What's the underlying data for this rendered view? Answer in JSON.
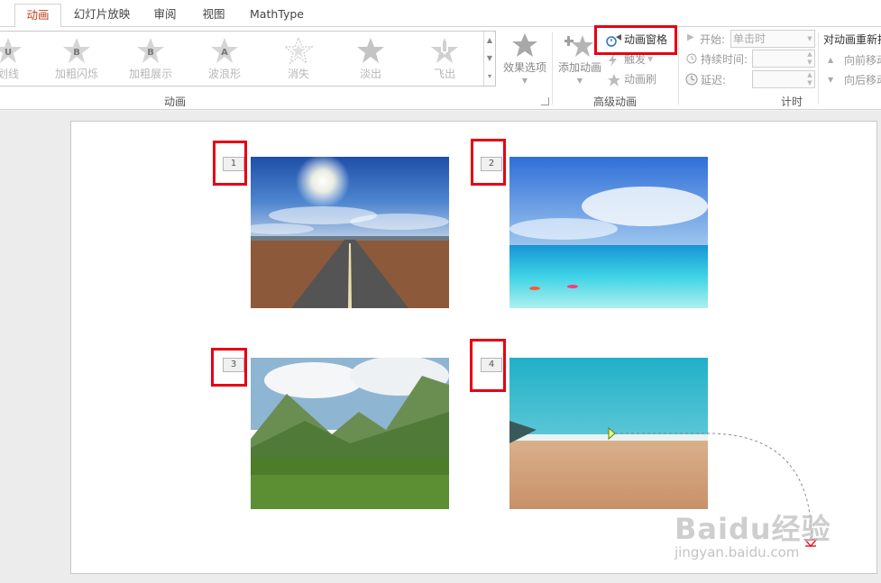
{
  "tabs": [
    {
      "label": "动画",
      "active": true
    },
    {
      "label": "幻灯片放映",
      "active": false
    },
    {
      "label": "审阅",
      "active": false
    },
    {
      "label": "视图",
      "active": false
    },
    {
      "label": "MathType",
      "active": false
    }
  ],
  "ribbon": {
    "gallery": {
      "items": [
        {
          "label": "划线",
          "icon": "underline-star-icon",
          "glyph": "U"
        },
        {
          "label": "加粗闪烁",
          "icon": "bold-flash-star-icon",
          "glyph": "B"
        },
        {
          "label": "加粗展示",
          "icon": "bold-reveal-star-icon",
          "glyph": "B"
        },
        {
          "label": "波浪形",
          "icon": "wave-star-icon",
          "glyph": "A"
        },
        {
          "label": "消失",
          "icon": "disappear-star-icon",
          "glyph": ""
        },
        {
          "label": "淡出",
          "icon": "fade-out-star-icon",
          "glyph": ""
        },
        {
          "label": "飞出",
          "icon": "fly-out-star-icon",
          "glyph": ""
        }
      ],
      "group_label": "动画"
    },
    "effect_options": "效果选项",
    "advanced": {
      "add_animation": "添加动画",
      "animation_pane": "动画窗格",
      "trigger": "触发",
      "animation_painter": "动画刷",
      "group_label": "高级动画"
    },
    "timing": {
      "start_label": "开始:",
      "start_value": "单击时",
      "duration_label": "持续时间:",
      "delay_label": "延迟:",
      "group_label": "计时"
    },
    "reorder": {
      "title": "对动画重新排",
      "move_earlier": "向前移动",
      "move_later": "向后移动"
    }
  },
  "slide": {
    "tags": [
      "1",
      "2",
      "3",
      "4"
    ]
  },
  "watermark": {
    "logo": "Baidu经验",
    "url": "jingyan.baidu.com"
  },
  "colors": {
    "accent": "#c43e1c",
    "highlight": "#e60012"
  }
}
